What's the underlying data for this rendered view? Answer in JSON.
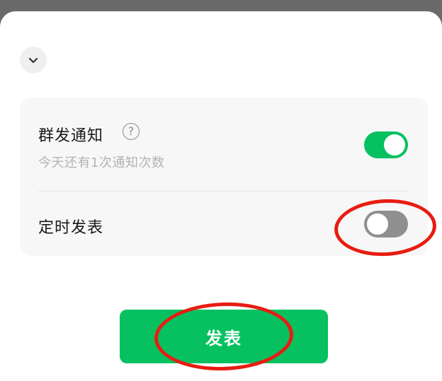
{
  "sheet": {
    "collapse_icon": "chevron-down-icon"
  },
  "settings": {
    "group_notify": {
      "title": "群发通知",
      "help_icon": "question-circle-icon",
      "help_glyph": "?",
      "subtext": "今天还有1次通知次数",
      "enabled": true
    },
    "scheduled_post": {
      "title": "定时发表",
      "enabled": false
    }
  },
  "actions": {
    "publish_label": "发表"
  },
  "colors": {
    "accent": "#07c160",
    "toggle_off": "#8f8f8f",
    "annotation": "#e81c12",
    "panel_bg": "#f7f7f7"
  }
}
